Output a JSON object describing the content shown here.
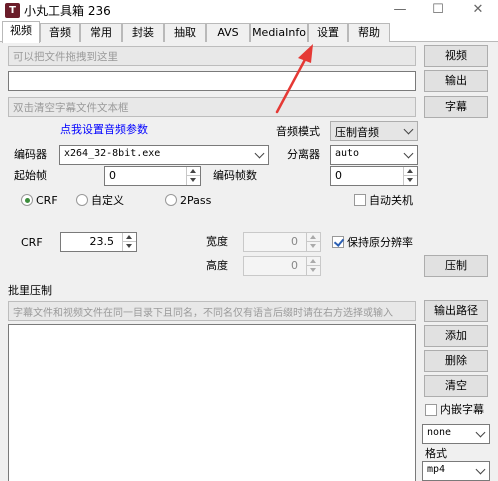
{
  "window": {
    "title": "小丸工具箱 236",
    "icon_glyph": "T",
    "minimize_glyph": "—",
    "maximize_glyph": "☐",
    "close_glyph": "✕"
  },
  "tabs": [
    "视频",
    "音频",
    "常用",
    "封装",
    "抽取",
    "AVS",
    "MediaInfo",
    "设置",
    "帮助"
  ],
  "active_tab": "视频",
  "inputs": {
    "video_placeholder": "可以把文件拖拽到这里",
    "output_value": "",
    "subtitle_placeholder": "双击清空字幕文件文本框"
  },
  "buttons": {
    "video": "视频",
    "output": "输出",
    "subtitle": "字幕",
    "encode": "压制",
    "output_path": "输出路径",
    "add": "添加",
    "delete": "删除",
    "clear": "清空"
  },
  "settings_link": "点我设置音频参数",
  "audio_mode": {
    "label": "音频模式",
    "value": "压制音频"
  },
  "encoder": {
    "label": "编码器",
    "value": "x264_32-8bit.exe"
  },
  "splitter": {
    "label": "分离器",
    "value": "auto"
  },
  "start_frame": {
    "label": "起始帧",
    "value": "0"
  },
  "encode_frames": {
    "label": "编码帧数",
    "value": "0"
  },
  "rate_mode": {
    "options": [
      "CRF",
      "自定义",
      "2Pass"
    ],
    "selected": "CRF"
  },
  "shutdown": {
    "label": "自动关机",
    "checked": false
  },
  "crf": {
    "label": "CRF",
    "value": "23.5"
  },
  "width": {
    "label": "宽度",
    "value": "0"
  },
  "height": {
    "label": "高度",
    "value": "0"
  },
  "keep_resolution": {
    "label": "保持原分辨率",
    "checked": true
  },
  "batch": {
    "title": "批里压制",
    "hint": "字幕文件和视频文件在同一目录下且同名，不同名仅有语言后缀时请在右方选择或输入",
    "items": []
  },
  "embed_subtitle": {
    "label": "内嵌字幕",
    "checked": false
  },
  "subtitle_lang": {
    "value": "none"
  },
  "format": {
    "label": "格式",
    "value": "mp4"
  },
  "colors": {
    "link": "#0000ff",
    "annotation_arrow": "#e53935",
    "panel_bg": "#f0f0f0"
  }
}
